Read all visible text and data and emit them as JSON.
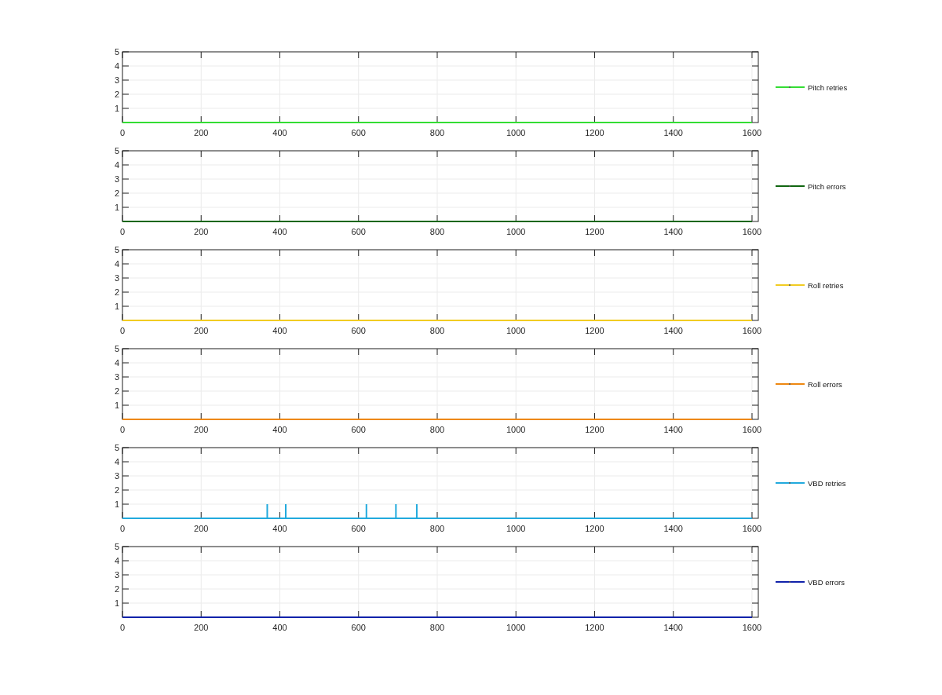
{
  "subplots": [
    {
      "chart_data": {
        "type": "line",
        "xlim": [
          0,
          1616
        ],
        "ylim": [
          0,
          5
        ],
        "xticks": [
          0,
          200,
          400,
          600,
          800,
          1000,
          1200,
          1400,
          1600
        ],
        "yticks": [
          1,
          2,
          3,
          4,
          5
        ],
        "grid": true,
        "series": [
          {
            "name": "Pitch retries",
            "color": "#33dd33",
            "x": [
              0,
              1600
            ],
            "values": [
              0,
              0
            ]
          }
        ]
      }
    },
    {
      "chart_data": {
        "type": "line",
        "xlim": [
          0,
          1616
        ],
        "ylim": [
          0,
          5
        ],
        "xticks": [
          0,
          200,
          400,
          600,
          800,
          1000,
          1200,
          1400,
          1600
        ],
        "yticks": [
          1,
          2,
          3,
          4,
          5
        ],
        "grid": true,
        "series": [
          {
            "name": "Pitch errors",
            "color": "#116611",
            "x": [
              0,
              1600
            ],
            "values": [
              0,
              0
            ]
          }
        ]
      }
    },
    {
      "chart_data": {
        "type": "line",
        "xlim": [
          0,
          1616
        ],
        "ylim": [
          0,
          5
        ],
        "xticks": [
          0,
          200,
          400,
          600,
          800,
          1000,
          1200,
          1400,
          1600
        ],
        "yticks": [
          1,
          2,
          3,
          4,
          5
        ],
        "grid": true,
        "series": [
          {
            "name": "Roll retries",
            "color": "#f2cc22",
            "x": [
              0,
              1600
            ],
            "values": [
              0,
              0
            ]
          }
        ]
      }
    },
    {
      "chart_data": {
        "type": "line",
        "xlim": [
          0,
          1616
        ],
        "ylim": [
          0,
          5
        ],
        "xticks": [
          0,
          200,
          400,
          600,
          800,
          1000,
          1200,
          1400,
          1600
        ],
        "yticks": [
          1,
          2,
          3,
          4,
          5
        ],
        "grid": true,
        "series": [
          {
            "name": "Roll errors",
            "color": "#ee8811",
            "x": [
              0,
              1600
            ],
            "values": [
              0,
              0
            ]
          }
        ]
      }
    },
    {
      "chart_data": {
        "type": "line",
        "xlim": [
          0,
          1616
        ],
        "ylim": [
          0,
          5
        ],
        "xticks": [
          0,
          200,
          400,
          600,
          800,
          1000,
          1200,
          1400,
          1600
        ],
        "yticks": [
          1,
          2,
          3,
          4,
          5
        ],
        "grid": true,
        "series": [
          {
            "name": "VBD retries",
            "color": "#22aadd",
            "x": [
              0,
              368,
              368,
              368,
              415,
              415,
              415,
              620,
              620,
              620,
              695,
              695,
              695,
              748,
              748,
              748,
              1600
            ],
            "values": [
              0,
              0,
              1,
              0,
              0,
              1,
              0,
              0,
              1,
              0,
              0,
              1,
              0,
              0,
              1,
              0,
              0
            ]
          }
        ]
      }
    },
    {
      "chart_data": {
        "type": "line",
        "xlim": [
          0,
          1616
        ],
        "ylim": [
          0,
          5
        ],
        "xticks": [
          0,
          200,
          400,
          600,
          800,
          1000,
          1200,
          1400,
          1600
        ],
        "yticks": [
          1,
          2,
          3,
          4,
          5
        ],
        "grid": true,
        "series": [
          {
            "name": "VBD errors",
            "color": "#1122aa",
            "x": [
              0,
              1600
            ],
            "values": [
              0,
              0
            ]
          }
        ]
      }
    }
  ]
}
